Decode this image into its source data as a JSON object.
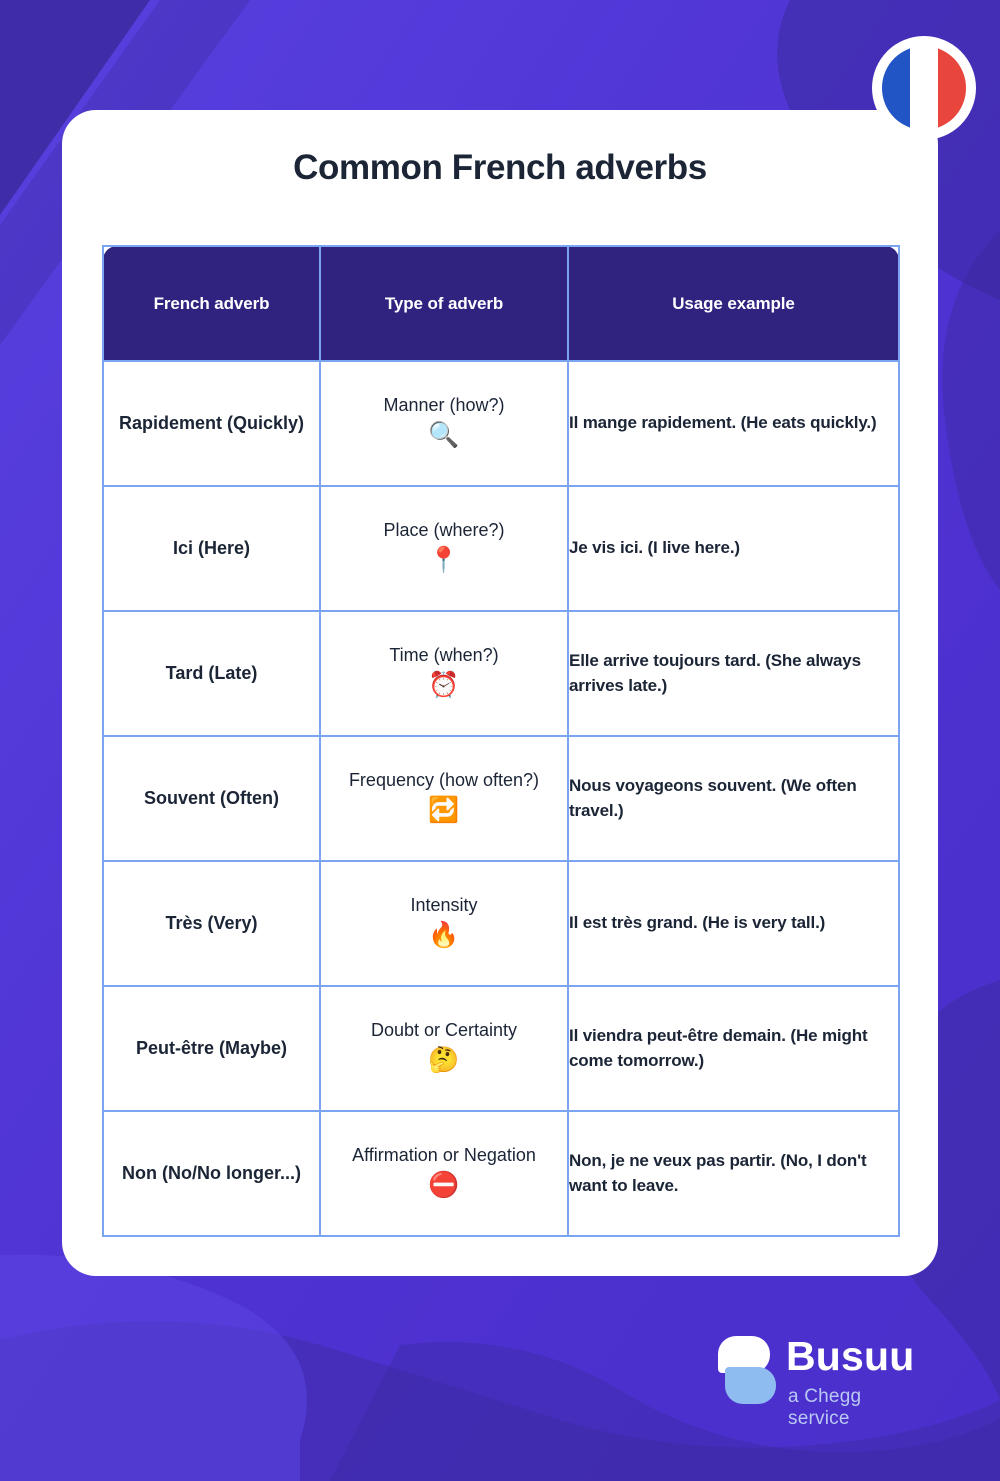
{
  "colors": {
    "background_purple": "#5236D4",
    "background_purple_dark": "#3B2A9E",
    "card_white": "#FFFFFF",
    "table_header_navy": "#30227F",
    "table_border_blue": "#7BA5F2",
    "text_dark": "#1B2536",
    "logo_blue": "#8FBCF0",
    "tagline_blue": "#B9C9F2"
  },
  "header": {
    "title": "Common French adverbs",
    "flag_badge": {
      "name": "french-flag",
      "stripes": [
        "#2154C4",
        "#FFFFFF",
        "#E8453C"
      ]
    }
  },
  "table": {
    "columns": [
      "French adverb",
      "Type of adverb",
      "Usage example"
    ],
    "rows": [
      {
        "adverb": "Rapidement (Quickly)",
        "type_label": "Manner (how?)",
        "type_emoji": "🔍",
        "type_emoji_name": "magnifying-glass-icon",
        "usage": "Il mange rapidement. (He eats quickly.)"
      },
      {
        "adverb": "Ici (Here)",
        "type_label": "Place (where?)",
        "type_emoji": "📍",
        "type_emoji_name": "round-pushpin-icon",
        "usage": "Je vis ici. (I live here.)"
      },
      {
        "adverb": "Tard (Late)",
        "type_label": "Time (when?)",
        "type_emoji": "⏰",
        "type_emoji_name": "alarm-clock-icon",
        "usage": "Elle arrive toujours tard. (She always arrives late.)"
      },
      {
        "adverb": "Souvent (Often)",
        "type_label": "Frequency (how often?)",
        "type_emoji": "🔁",
        "type_emoji_name": "repeat-icon",
        "usage": "Nous voyageons souvent. (We often travel.)"
      },
      {
        "adverb": "Très (Very)",
        "type_label": "Intensity",
        "type_emoji": "🔥",
        "type_emoji_name": "fire-icon",
        "usage": "Il est très grand. (He is very tall.)"
      },
      {
        "adverb": "Peut-être (Maybe)",
        "type_label": "Doubt or Certainty",
        "type_emoji": "🤔",
        "type_emoji_name": "thinking-face-icon",
        "usage": "Il viendra peut-être demain. (He might come tomorrow.)"
      },
      {
        "adverb": "Non (No/No longer...)",
        "type_label": "Affirmation or Negation",
        "type_emoji": "⛔",
        "type_emoji_name": "no-entry-icon",
        "usage": "Non, je ne veux pas partir. (No, I don't want to leave."
      }
    ]
  },
  "footer": {
    "logo_name": "busuu-logo",
    "brand": "Busuu",
    "tagline": "a Chegg service"
  }
}
